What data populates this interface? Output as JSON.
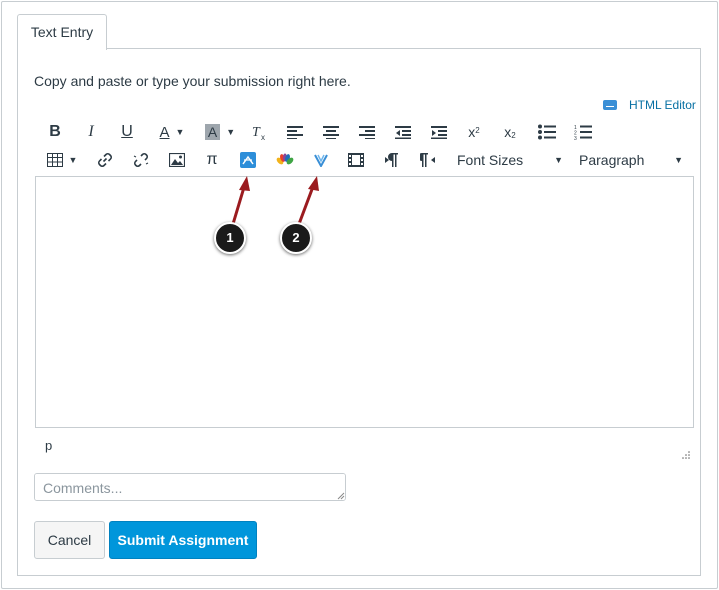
{
  "tab": {
    "label": "Text Entry"
  },
  "instructions": "Copy and paste or type your submission right here.",
  "html_editor": {
    "label": "HTML Editor"
  },
  "toolbar": {
    "font_sizes": "Font Sizes",
    "paragraph": "Paragraph",
    "pi": "π",
    "superscript_base": "x",
    "superscript_exp": "2",
    "subscript_base": "x",
    "subscript_exp": "2"
  },
  "status_path": "p",
  "comments": {
    "placeholder": "Comments..."
  },
  "buttons": {
    "cancel": "Cancel",
    "submit": "Submit Assignment"
  },
  "callouts": [
    "1",
    "2"
  ],
  "colors": {
    "accent": "#0096db",
    "link": "#0770a3",
    "callout_arrow": "#9b1b1f"
  }
}
